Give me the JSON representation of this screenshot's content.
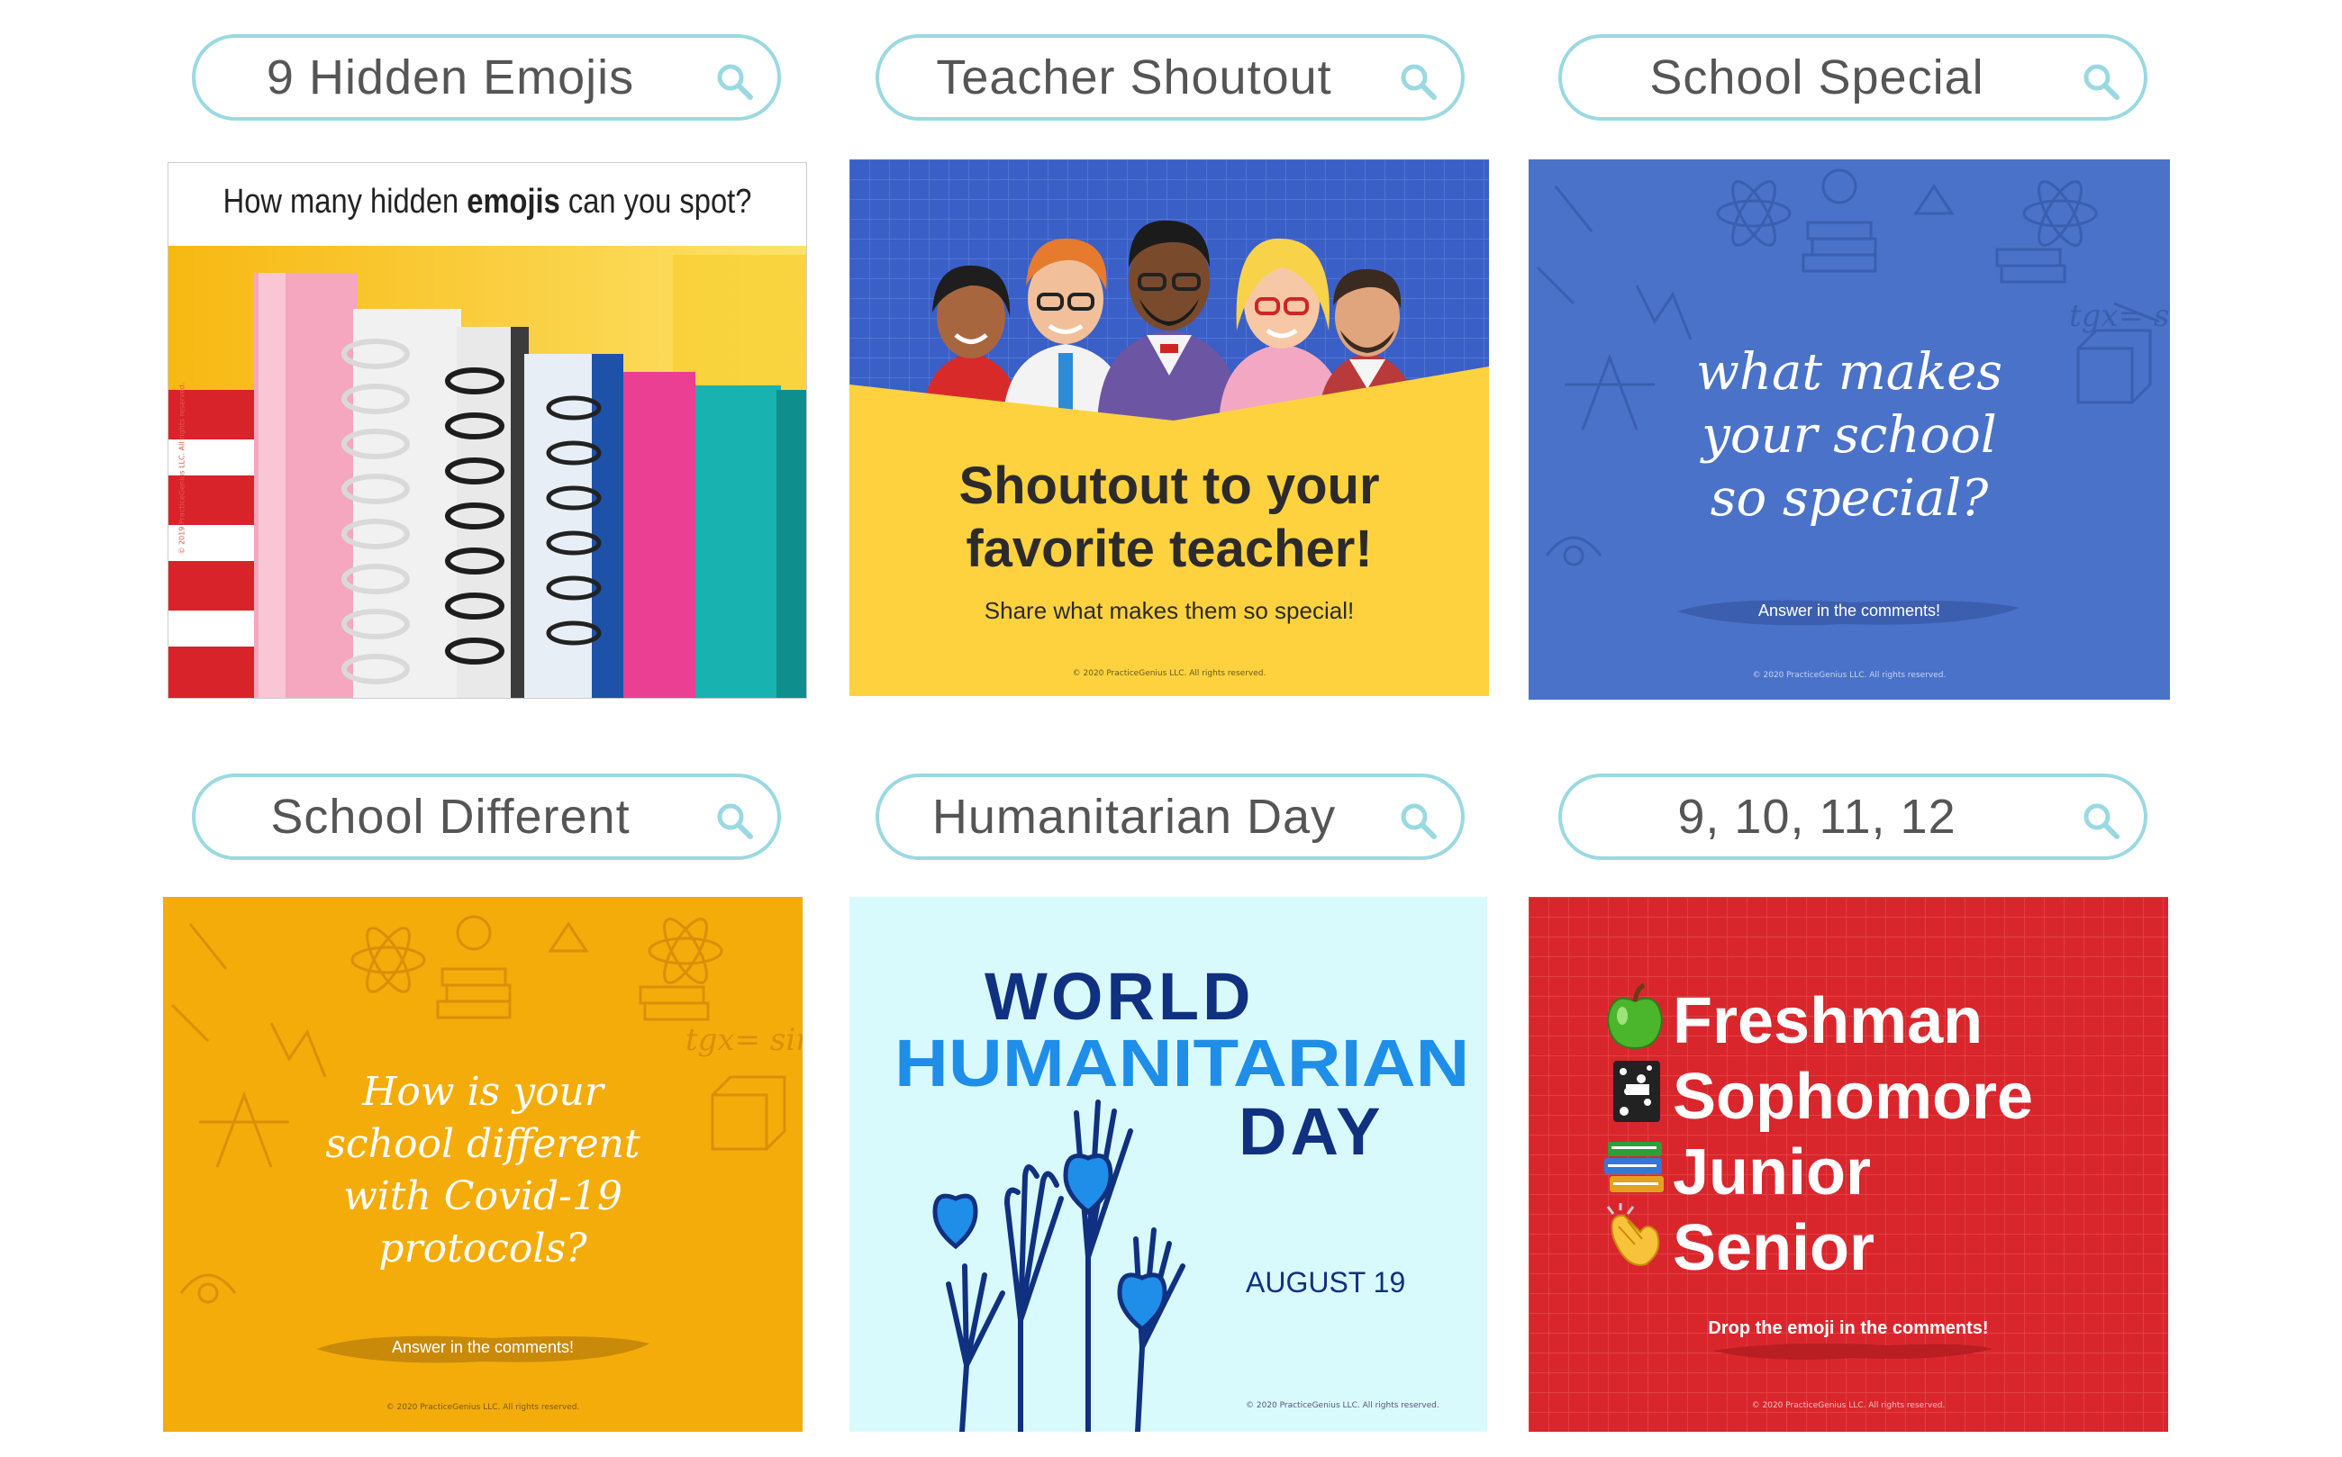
{
  "cards": [
    {
      "query": "9 Hidden Emojis",
      "headline_pre": "How many hidden ",
      "headline_bold": "emojis",
      "headline_post": " can you spot?",
      "side_copyright": "© 2019 PracticeGenius LLC. All rights reserved."
    },
    {
      "query": "Teacher Shoutout",
      "title_line1": "Shoutout to your",
      "title_line2": "favorite teacher!",
      "subtitle": "Share what makes them so special!",
      "copyright": "© 2020 PracticeGenius LLC. All rights reserved."
    },
    {
      "query": "School Special",
      "line1": "what makes",
      "line2": "your school",
      "line3": "so special?",
      "cta": "Answer in the comments!",
      "copyright": "© 2020 PracticeGenius LLC. All rights reserved."
    },
    {
      "query": "School Different",
      "line1": "How is your",
      "line2": "school different",
      "line3": "with Covid-19",
      "line4": "protocols?",
      "cta": "Answer in the comments!",
      "copyright": "© 2020 PracticeGenius LLC. All rights reserved."
    },
    {
      "query": "Humanitarian Day",
      "title1": "WORLD",
      "title2": "HUMANITARIAN",
      "title3": "DAY",
      "date": "AUGUST 19",
      "copyright": "© 2020 PracticeGenius LLC. All rights reserved."
    },
    {
      "query": "9, 10, 11, 12",
      "rows": [
        "Freshman",
        "Sophomore",
        "Junior",
        "Senior"
      ],
      "emojis": [
        "apple-emoji",
        "composition-notebook-emoji",
        "books-emoji",
        "clapping-hands-emoji"
      ],
      "cta": "Drop the emoji in the comments!",
      "copyright": "© 2020 PracticeGenius LLC. All rights reserved."
    }
  ],
  "colors": {
    "search_border": "#9ad9e2",
    "teacher_bg": "#3a5fc6",
    "teacher_yellow": "#fdd23e",
    "special_blue": "#4a72c8",
    "different_yellow": "#f4ac0b",
    "humanitarian_bg": "#d9fafd",
    "humanitarian_navy": "#10317f",
    "humanitarian_blue": "#1f8ee9",
    "grades_red": "#d9262c"
  }
}
